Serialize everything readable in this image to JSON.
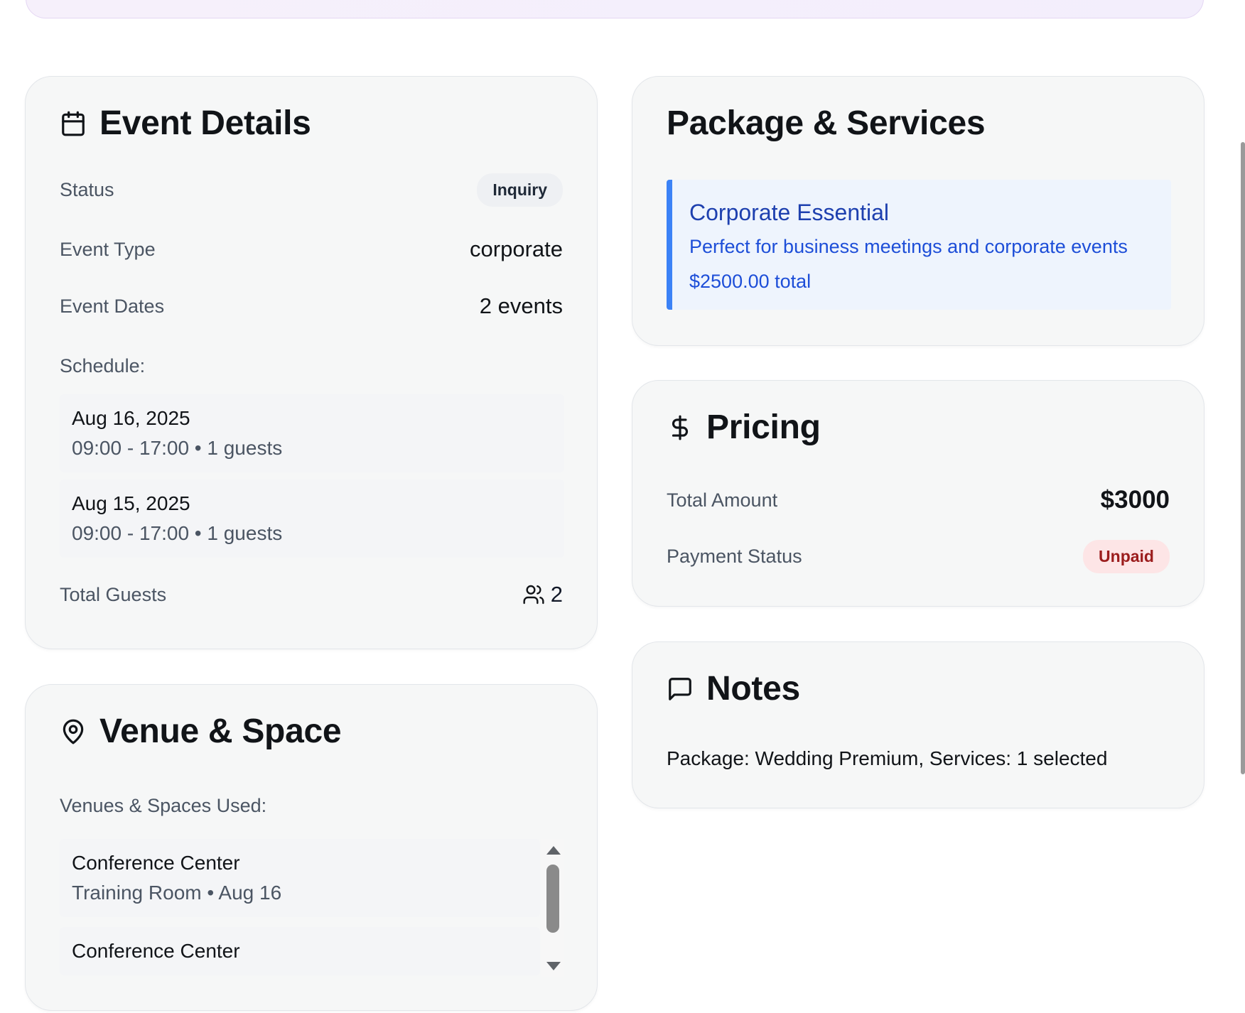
{
  "event_details": {
    "title": "Event Details",
    "status_label": "Status",
    "status_value": "Inquiry",
    "event_type_label": "Event Type",
    "event_type_value": "corporate",
    "event_dates_label": "Event Dates",
    "event_dates_value": "2 events",
    "schedule_label": "Schedule:",
    "schedule": [
      {
        "date": "Aug 16, 2025",
        "details": "09:00 - 17:00 • 1 guests"
      },
      {
        "date": "Aug 15, 2025",
        "details": "09:00 - 17:00 • 1 guests"
      }
    ],
    "total_guests_label": "Total Guests",
    "total_guests_value": "2"
  },
  "venue": {
    "title": "Venue & Space",
    "used_label": "Venues & Spaces Used:",
    "items": [
      {
        "venue": "Conference Center",
        "details": "Training Room • Aug 16"
      },
      {
        "venue": "Conference Center",
        "details": ""
      }
    ]
  },
  "package": {
    "title": "Package & Services",
    "name": "Corporate Essential",
    "description": "Perfect for business meetings and corporate events",
    "price": "$2500.00 total"
  },
  "pricing": {
    "title": "Pricing",
    "total_label": "Total Amount",
    "total_value": "$3000",
    "payment_status_label": "Payment Status",
    "payment_status_value": "Unpaid"
  },
  "notes": {
    "title": "Notes",
    "text": "Package: Wedding Premium, Services: 1 selected"
  },
  "colors": {
    "accent_blue": "#3b82f6",
    "unpaid_red": "#9b1c1c",
    "card_bg": "#f6f7f7"
  },
  "icons": {
    "event_details": "calendar-icon",
    "venue": "map-pin-icon",
    "pricing": "dollar-icon",
    "notes": "message-square-icon",
    "guests": "users-icon"
  }
}
